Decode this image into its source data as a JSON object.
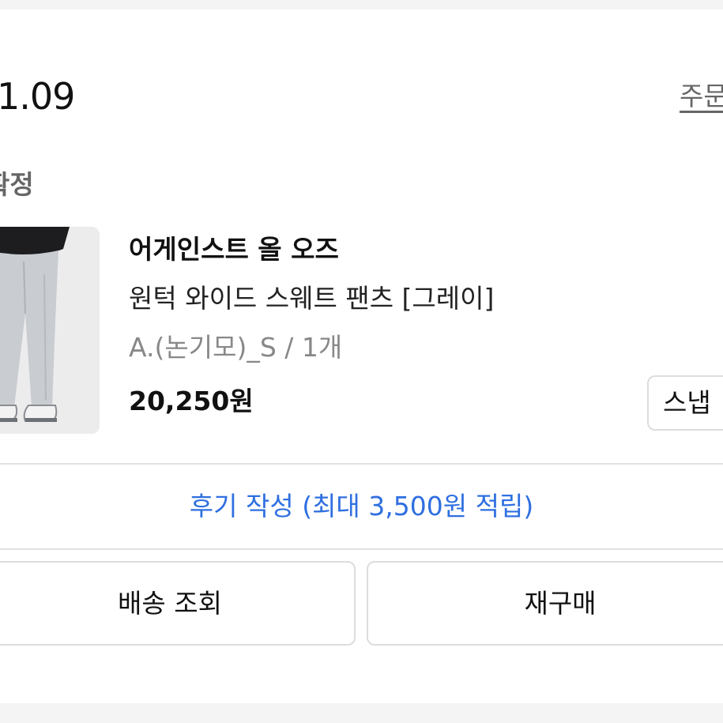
{
  "order": {
    "date": "1.09",
    "detail_link": "주문",
    "status": "확정"
  },
  "product": {
    "brand": "어게인스트 올 오즈",
    "name": "원턱 와이드 스웨트 팬츠 [그레이]",
    "option": "A.(논기모)_S / 1개",
    "price": "20,250원",
    "snap_label": "스냅"
  },
  "actions": {
    "review_label": "후기 작성 (최대 3,500원 적립)",
    "delivery_label": "배송 조회",
    "rebuy_label": "재구매"
  },
  "colors": {
    "accent_link": "#2f6fe0",
    "pants": "#c9ccd1",
    "top": "#1d1d1f"
  }
}
